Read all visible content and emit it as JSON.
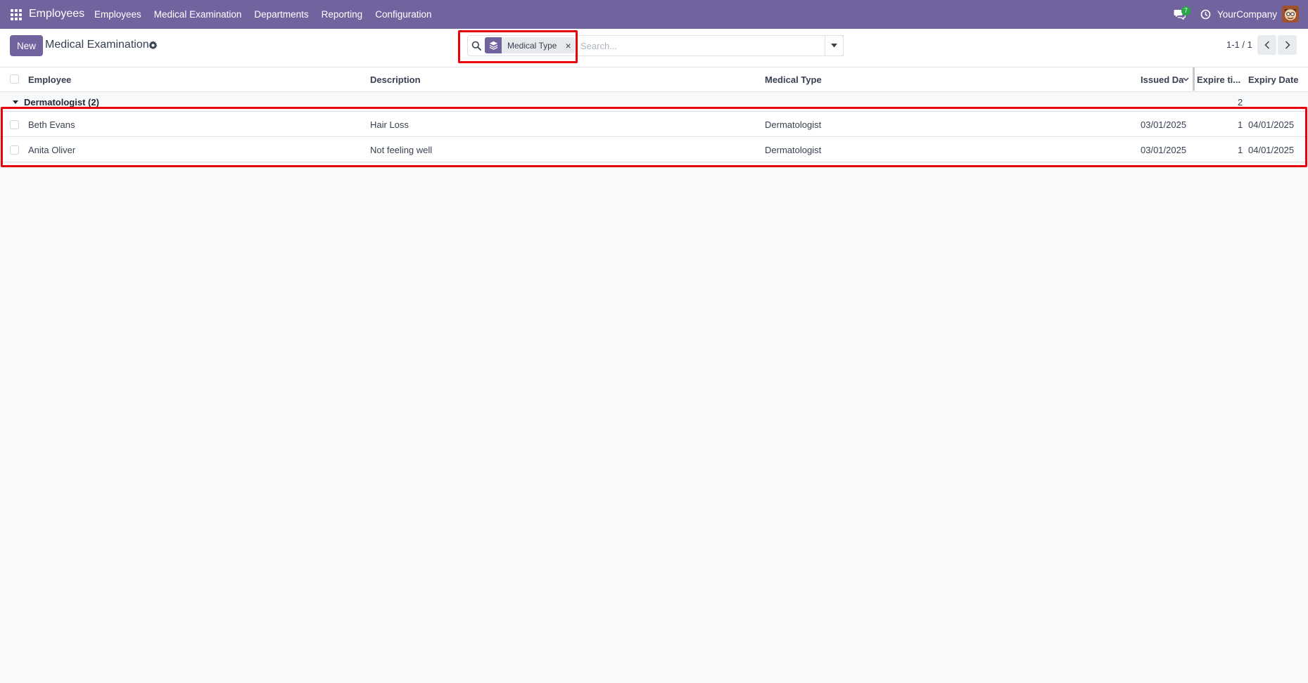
{
  "app": {
    "brand": "Employees"
  },
  "menu": [
    {
      "label": "Employees"
    },
    {
      "label": "Medical Examination"
    },
    {
      "label": "Departments"
    },
    {
      "label": "Reporting"
    },
    {
      "label": "Configuration"
    }
  ],
  "topbar": {
    "chat_badge": "7",
    "company": "YourCompany"
  },
  "control": {
    "new_label": "New",
    "title": "Medical Examination",
    "facet_label": "Medical Type",
    "facet_close": "×",
    "search_placeholder": "Search...",
    "pager": "1-1 / 1"
  },
  "table": {
    "headers": {
      "employee": "Employee",
      "description": "Description",
      "medical_type": "Medical Type",
      "issued_date": "Issued Da",
      "expire_time": "Expire ti...",
      "expiry_date": "Expiry Date"
    },
    "group": {
      "label": "Dermatologist (2)",
      "count": "2"
    },
    "rows": [
      {
        "employee": "Beth Evans",
        "description": "Hair Loss",
        "medical_type": "Dermatologist",
        "issued_date": "03/01/2025",
        "expire_time": "1",
        "expiry_date": "04/01/2025"
      },
      {
        "employee": "Anita Oliver",
        "description": "Not feeling well",
        "medical_type": "Dermatologist",
        "issued_date": "03/01/2025",
        "expire_time": "1",
        "expiry_date": "04/01/2025"
      }
    ]
  },
  "colors": {
    "brand": "#71639e",
    "highlight": "#e8000b"
  }
}
